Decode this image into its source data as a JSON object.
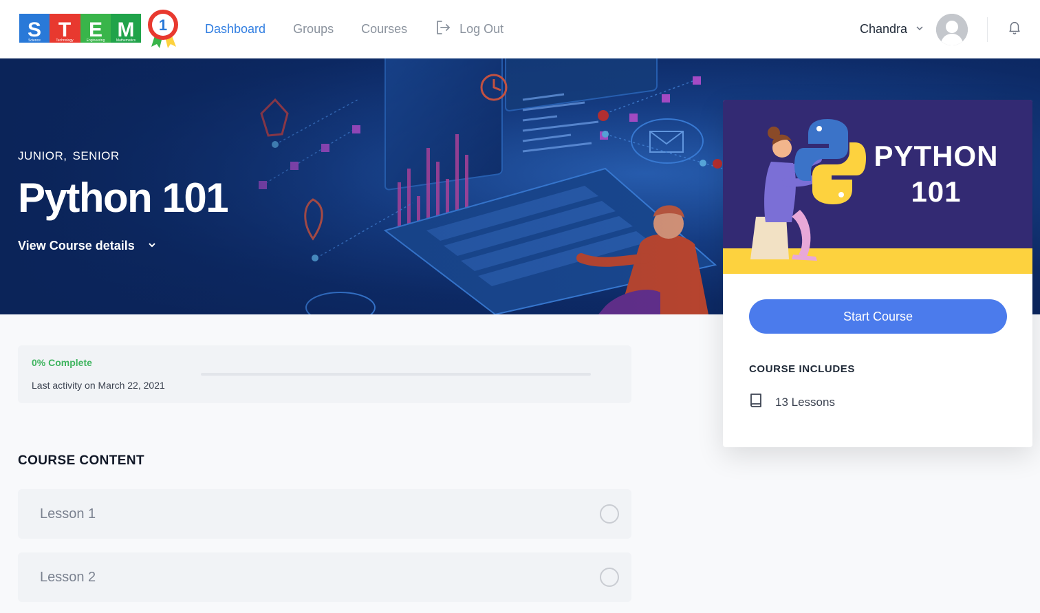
{
  "header": {
    "logo": {
      "letters": [
        "S",
        "T",
        "E",
        "M"
      ],
      "sublabels": [
        "Science",
        "Technology",
        "Engineering",
        "Mathematics"
      ],
      "badge_number": "1",
      "colors": [
        "#2979d8",
        "#e8392f",
        "#39b54a",
        "#20a34a"
      ]
    },
    "nav": [
      {
        "label": "Dashboard",
        "active": true
      },
      {
        "label": "Groups",
        "active": false
      },
      {
        "label": "Courses",
        "active": false
      },
      {
        "label": "Log Out",
        "icon": "logout-icon",
        "active": false
      }
    ],
    "user_name": "Chandra"
  },
  "hero": {
    "categories": [
      "JUNIOR,",
      "SENIOR"
    ],
    "title": "Python 101",
    "details_label": "View Course details"
  },
  "progress": {
    "percent_label": "0% Complete",
    "percent": 0,
    "last_activity": "Last activity on March 22, 2021"
  },
  "content": {
    "title": "COURSE CONTENT",
    "lessons": [
      {
        "label": "Lesson 1"
      },
      {
        "label": "Lesson 2"
      }
    ]
  },
  "side": {
    "thumb_title_line1": "PYTHON",
    "thumb_title_line2": "101",
    "start_label": "Start Course",
    "includes_title": "COURSE INCLUDES",
    "includes": [
      {
        "icon": "book-icon",
        "label": "13 Lessons"
      }
    ]
  },
  "colors": {
    "accent": "#2f7de1",
    "button": "#4b7bec",
    "complete": "#3fb45f",
    "thumb_bg": "#332a73",
    "thumb_stripe": "#fdd23e"
  }
}
